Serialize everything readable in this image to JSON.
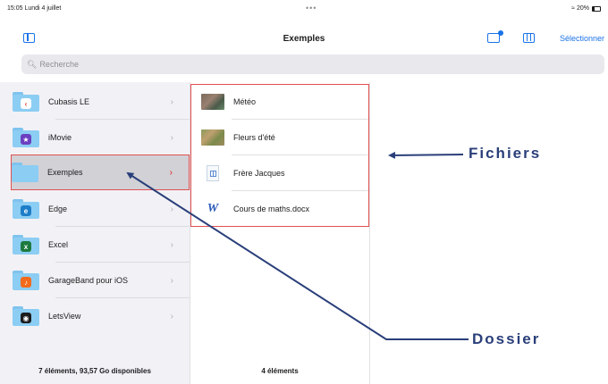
{
  "status_bar": {
    "time_date": "15:05  Lundi 4 juillet",
    "dots": "•••",
    "wifi": "≈",
    "battery_text": "20%"
  },
  "nav": {
    "title": "Exemples",
    "select_label": "Sélectionner"
  },
  "search": {
    "placeholder": "Recherche"
  },
  "folders": [
    {
      "name": "Cubasis LE",
      "badge": "‹",
      "badge_color": "#e0362c"
    },
    {
      "name": "iMovie",
      "badge": "★",
      "badge_color": "#6b3fc0"
    },
    {
      "name": "Exemples",
      "badge": "",
      "badge_color": ""
    },
    {
      "name": "Edge",
      "badge": "e",
      "badge_color": "#1e7ec8"
    },
    {
      "name": "Excel",
      "badge": "x",
      "badge_color": "#1d7a3e"
    },
    {
      "name": "GarageBand pour iOS",
      "badge": "♪",
      "badge_color": "#f26b1d"
    },
    {
      "name": "LetsView",
      "badge": "◉",
      "badge_color": "#1c1c1e"
    }
  ],
  "files": [
    {
      "name": "Météo",
      "icon": "photo-thumbnail"
    },
    {
      "name": "Fleurs d'été",
      "icon": "photo-thumbnail"
    },
    {
      "name": "Frère Jacques",
      "icon": "document-icon"
    },
    {
      "name": "Cours de maths.docx",
      "icon": "word-icon",
      "glyph": "W"
    }
  ],
  "footer": {
    "left": "7 éléments, 93,57 Go disponibles",
    "mid": "4 éléments"
  },
  "annotations": {
    "fichiers": "Fichiers",
    "dossier": "Dossier",
    "color": "#2a3f7a"
  },
  "colors": {
    "accent": "#1a73e8",
    "highlight_border": "#e05050"
  }
}
